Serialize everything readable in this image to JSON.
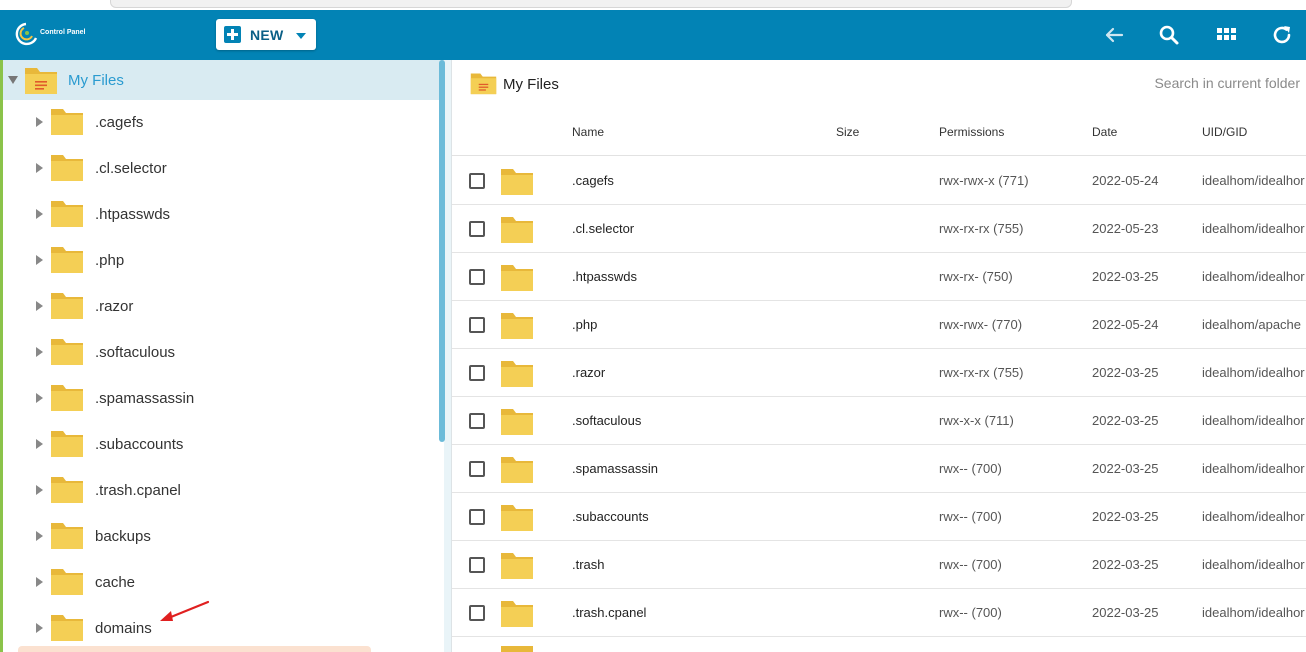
{
  "topbar": {
    "logo_text": "Control Panel",
    "new_label": "NEW",
    "icons": [
      "back-arrow-icon",
      "search-icon",
      "grid-view-icon",
      "refresh-icon"
    ]
  },
  "tree": {
    "root_label": "My Files",
    "items": [
      ".cagefs",
      ".cl.selector",
      ".htpasswds",
      ".php",
      ".razor",
      ".softaculous",
      ".spamassassin",
      ".subaccounts",
      ".trash.cpanel",
      "backups",
      "cache",
      "domains"
    ]
  },
  "main": {
    "title": "My Files",
    "search_placeholder": "Search in current folder",
    "columns": {
      "name": "Name",
      "size": "Size",
      "permissions": "Permissions",
      "date": "Date",
      "uid": "UID/GID"
    },
    "rows": [
      {
        "name": ".cagefs",
        "permissions": "rwx-rwx-x (771)",
        "date": "2022-05-24",
        "uid": "idealhom/idealhor"
      },
      {
        "name": ".cl.selector",
        "permissions": "rwx-rx-rx (755)",
        "date": "2022-05-23",
        "uid": "idealhom/idealhor"
      },
      {
        "name": ".htpasswds",
        "permissions": "rwx-rx- (750)",
        "date": "2022-03-25",
        "uid": "idealhom/idealhor"
      },
      {
        "name": ".php",
        "permissions": "rwx-rwx- (770)",
        "date": "2022-05-24",
        "uid": "idealhom/apache"
      },
      {
        "name": ".razor",
        "permissions": "rwx-rx-rx (755)",
        "date": "2022-03-25",
        "uid": "idealhom/idealhor"
      },
      {
        "name": ".softaculous",
        "permissions": "rwx-x-x (711)",
        "date": "2022-03-25",
        "uid": "idealhom/idealhor"
      },
      {
        "name": ".spamassassin",
        "permissions": "rwx-- (700)",
        "date": "2022-03-25",
        "uid": "idealhom/idealhor"
      },
      {
        "name": ".subaccounts",
        "permissions": "rwx-- (700)",
        "date": "2022-03-25",
        "uid": "idealhom/idealhor"
      },
      {
        "name": ".trash",
        "permissions": "rwx-- (700)",
        "date": "2022-03-25",
        "uid": "idealhom/idealhor"
      },
      {
        "name": ".trash.cpanel",
        "permissions": "rwx-- (700)",
        "date": "2022-03-25",
        "uid": "idealhom/idealhor"
      }
    ]
  },
  "colors": {
    "topbar": "#0283b5",
    "folder": "#f4cf55",
    "accent": "#2a9bd0",
    "annotation_arrow": "#e02020"
  }
}
